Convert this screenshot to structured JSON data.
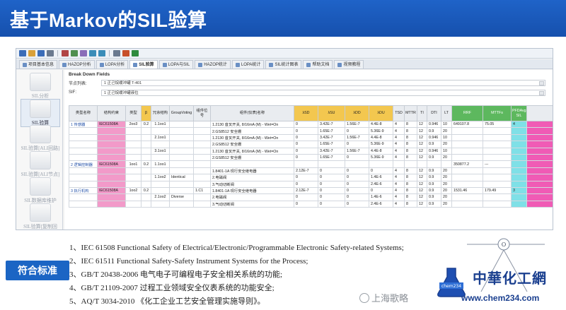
{
  "banner": {
    "title": "基于Markov的SIL验算"
  },
  "colors": {
    "banner": "#1b5fc2",
    "yellow_header": "#f3c74f",
    "green_header": "#5db85e",
    "pink_cell": "#f29ac9",
    "cyan_cell": "#7fe0e7",
    "magenta_cell": "#f05bb5",
    "badge": "#1b65c4"
  },
  "toolbar": {
    "icons": [
      "new-icon",
      "open-icon",
      "save-icon",
      "print-icon",
      "cut-icon",
      "copy-icon",
      "paste-icon",
      "undo-icon",
      "redo-icon",
      "table-icon",
      "chart-icon",
      "excel-icon"
    ]
  },
  "tabs": [
    {
      "label": "项目基本信息"
    },
    {
      "label": "HAZOP分析"
    },
    {
      "label": "LOPA分析"
    },
    {
      "label": "SIL验算"
    },
    {
      "label": "LOPA与SIL"
    },
    {
      "label": "HAZOP统计"
    },
    {
      "label": "LOPA统计"
    },
    {
      "label": "SIL统计图表"
    },
    {
      "label": "帮助文档"
    },
    {
      "label": "视频教程"
    }
  ],
  "active_tab_index": 3,
  "leftnav": [
    {
      "label": "SIL分析"
    },
    {
      "label": "SIL验算"
    },
    {
      "label": "SIL验算[ALI回路]"
    },
    {
      "label": "SIL验算[ALI节点]"
    },
    {
      "label": "SIL数据库维护"
    },
    {
      "label": "SIL验算[复制回路]"
    }
  ],
  "main": {
    "section_label": "Break Down Fields",
    "fields": [
      {
        "label": "节点列表:",
        "value": "1 正己烷缓冲罐 T-401"
      },
      {
        "label": "SIF:",
        "value": "1 正己烷缓冲罐液位"
      }
    ]
  },
  "table": {
    "headers": [
      "类型名称",
      "结构约束",
      "类型",
      "β",
      "冗余结构",
      "GroupVoting",
      "组件位号",
      "组件(仪表)名称",
      "λSD",
      "λSU",
      "λDD",
      "λDU",
      "TSD",
      "MTTR",
      "TI",
      "DTI",
      "LT",
      "RRF",
      "MTTFs",
      "PFDAvg SIL",
      ""
    ],
    "rows": [
      [
        "1 传感器",
        "IEC61508A",
        "2oo3",
        "0.2",
        "1.1oo1",
        "",
        "",
        "1.2130 音叉开关, 8/16mA (M) - Wet=On",
        "0",
        "3.42E-7",
        "1.56E-7",
        "4.4E-8",
        "4",
        "8",
        "12",
        "0.946",
        "10",
        "649107.8",
        "75.05",
        "4",
        ""
      ],
      [
        "",
        "",
        "",
        "",
        "",
        "",
        "",
        "2.GS8512 安全栅",
        "0",
        "1.65E-7",
        "0",
        "5.36E-9",
        "4",
        "8",
        "12",
        "0.9",
        "20",
        "",
        "",
        "",
        ""
      ],
      [
        "",
        "",
        "",
        "",
        "2.1oo1",
        "",
        "",
        "1.2130 音叉开关, 8/16mA (M) - Wet=On",
        "0",
        "3.42E-7",
        "1.56E-7",
        "4.4E-8",
        "4",
        "8",
        "12",
        "0.946",
        "10",
        "",
        "",
        "",
        ""
      ],
      [
        "",
        "",
        "",
        "",
        "",
        "",
        "",
        "2.GS8512 安全栅",
        "0",
        "1.65E-7",
        "0",
        "5.36E-9",
        "4",
        "8",
        "12",
        "0.9",
        "20",
        "",
        "",
        "",
        ""
      ],
      [
        "",
        "",
        "",
        "",
        "3.1oo1",
        "",
        "",
        "1.2130 音叉开关, 8/16mA (M) - Wet=On",
        "0",
        "3.42E-7",
        "1.56E-7",
        "4.4E-8",
        "4",
        "8",
        "12",
        "0.946",
        "10",
        "",
        "",
        "",
        ""
      ],
      [
        "",
        "",
        "",
        "",
        "",
        "",
        "",
        "2.GS8512 安全栅",
        "0",
        "1.65E-7",
        "0",
        "5.36E-9",
        "4",
        "8",
        "12",
        "0.9",
        "20",
        "",
        "",
        "",
        ""
      ],
      [
        "2 逻辑控制器",
        "IEC61508A",
        "1oo1",
        "0.2",
        "1.1oo1",
        "",
        "",
        "",
        "",
        "",
        "",
        "",
        "",
        "",
        "",
        "",
        "",
        "350877.2",
        "---",
        "",
        ""
      ],
      [
        "",
        "",
        "",
        "",
        "",
        "",
        "",
        "1.8401-1A 现行安全继电器",
        "2.12E-7",
        "0",
        "0",
        "0",
        "4",
        "8",
        "12",
        "0.9",
        "20",
        "",
        "",
        "",
        ""
      ],
      [
        "",
        "",
        "",
        "",
        "1.1oo2",
        "Identical",
        "",
        "2.电磁阀",
        "0",
        "0",
        "0",
        "1.4E-6",
        "4",
        "8",
        "12",
        "0.9",
        "20",
        "",
        "",
        "",
        ""
      ],
      [
        "",
        "",
        "",
        "",
        "",
        "",
        "",
        "3.气动切断阀",
        "0",
        "0",
        "0",
        "2.4E-6",
        "4",
        "8",
        "12",
        "0.9",
        "20",
        "",
        "",
        "",
        ""
      ],
      [
        "3 执行机构",
        "IEC61508A",
        "1oo2",
        "0.2",
        "",
        "",
        "1.C1",
        "1.8401-1A 现行安全继电器",
        "2.12E-7",
        "0",
        "0",
        "0",
        "4",
        "8",
        "12",
        "0.9",
        "20",
        "1531.46",
        "179.49",
        "3",
        ""
      ],
      [
        "",
        "",
        "",
        "",
        "2.1oo2",
        "Diverse",
        "",
        "2.电磁阀",
        "0",
        "0",
        "0",
        "1.4E-6",
        "4",
        "8",
        "12",
        "0.9",
        "20",
        "",
        "",
        "",
        ""
      ],
      [
        "",
        "",
        "",
        "",
        "",
        "",
        "",
        "3.气动切断阀",
        "0",
        "0",
        "0",
        "2.4E-6",
        "4",
        "8",
        "12",
        "0.9",
        "20",
        "",
        "",
        "",
        ""
      ]
    ]
  },
  "standards": {
    "badge": "符合标准",
    "items": [
      "1、IEC 61508 Functional Safety of Electrical/Electronic/Programmable Electronic Safety-related Systems;",
      "2、IEC 61511 Functional Safety-Safety Instrument Systems for the Process;",
      "3、GB/T 20438-2006 电气电子可编程电子安全相关系统的功能;",
      "4、GB/T 21109-2007 过程工业领域安全仪表系统的功能安全;",
      "5、AQ/T 3034-2010 《化工企业工艺安全管理实施导则》。"
    ]
  },
  "watermark": {
    "text": "上海歌略",
    "icon": "wechat-icon"
  },
  "logo": {
    "cn": "中華化工網",
    "url": "www.chem234.com",
    "flask_text": "chem234"
  }
}
